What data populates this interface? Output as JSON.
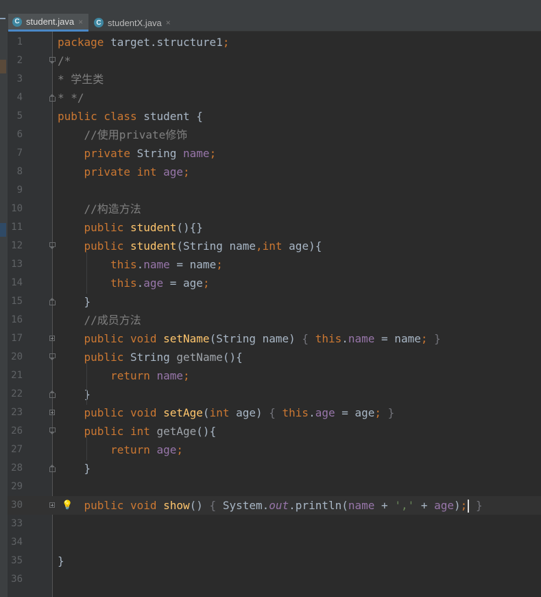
{
  "tabs": [
    {
      "label": "student.java",
      "active": true,
      "icon": "class-icon"
    },
    {
      "label": "studentX.java",
      "active": false,
      "icon": "class-icon"
    }
  ],
  "lines": [
    {
      "n": "1",
      "tokens": [
        [
          "kw",
          "package "
        ],
        [
          "pl",
          "target.structure1"
        ],
        [
          "kw",
          ";"
        ]
      ]
    },
    {
      "n": "2",
      "tokens": [
        [
          "cm",
          "/*"
        ]
      ],
      "fold": "open"
    },
    {
      "n": "3",
      "tokens": [
        [
          "cm",
          "* 学生类"
        ]
      ]
    },
    {
      "n": "4",
      "tokens": [
        [
          "cm",
          "* */"
        ]
      ],
      "fold": "close"
    },
    {
      "n": "5",
      "tokens": [
        [
          "kw",
          "public class "
        ],
        [
          "pl",
          "student {"
        ]
      ]
    },
    {
      "n": "6",
      "tokens": [
        [
          "pl",
          "    "
        ],
        [
          "cm",
          "//使用private修饰"
        ]
      ]
    },
    {
      "n": "7",
      "tokens": [
        [
          "pl",
          "    "
        ],
        [
          "kw",
          "private "
        ],
        [
          "pl",
          "String "
        ],
        [
          "fld",
          "name"
        ],
        [
          "kw",
          ";"
        ]
      ]
    },
    {
      "n": "8",
      "tokens": [
        [
          "pl",
          "    "
        ],
        [
          "kw",
          "private int "
        ],
        [
          "fld",
          "age"
        ],
        [
          "kw",
          ";"
        ]
      ]
    },
    {
      "n": "9",
      "tokens": []
    },
    {
      "n": "10",
      "tokens": [
        [
          "pl",
          "    "
        ],
        [
          "cm",
          "//构造方法"
        ]
      ]
    },
    {
      "n": "11",
      "tokens": [
        [
          "pl",
          "    "
        ],
        [
          "kw",
          "public "
        ],
        [
          "fn",
          "student"
        ],
        [
          "pl",
          "(){}"
        ]
      ]
    },
    {
      "n": "12",
      "tokens": [
        [
          "pl",
          "    "
        ],
        [
          "kw",
          "public "
        ],
        [
          "fn",
          "student"
        ],
        [
          "pl",
          "(String name"
        ],
        [
          "kw",
          ","
        ],
        [
          "kw",
          "int "
        ],
        [
          "pl",
          "age){"
        ]
      ],
      "fold": "open"
    },
    {
      "n": "13",
      "tokens": [
        [
          "pl",
          "        "
        ],
        [
          "kw",
          "this"
        ],
        [
          "pl",
          "."
        ],
        [
          "fld",
          "name"
        ],
        [
          "pl",
          " = name"
        ],
        [
          "kw",
          ";"
        ]
      ]
    },
    {
      "n": "14",
      "tokens": [
        [
          "pl",
          "        "
        ],
        [
          "kw",
          "this"
        ],
        [
          "pl",
          "."
        ],
        [
          "fld",
          "age"
        ],
        [
          "pl",
          " = age"
        ],
        [
          "kw",
          ";"
        ]
      ]
    },
    {
      "n": "15",
      "tokens": [
        [
          "pl",
          "    }"
        ]
      ],
      "fold": "close"
    },
    {
      "n": "16",
      "tokens": [
        [
          "pl",
          "    "
        ],
        [
          "cm",
          "//成员方法"
        ]
      ]
    },
    {
      "n": "17",
      "tokens": [
        [
          "pl",
          "    "
        ],
        [
          "kw",
          "public void "
        ],
        [
          "fn",
          "setName"
        ],
        [
          "pl",
          "(String name)"
        ],
        [
          "gray",
          " { "
        ],
        [
          "kw",
          "this"
        ],
        [
          "pl",
          "."
        ],
        [
          "fld",
          "name"
        ],
        [
          "pl",
          " = name"
        ],
        [
          "kw",
          ";"
        ],
        [
          "gray",
          " }"
        ]
      ],
      "fold": "collapsed"
    },
    {
      "n": "20",
      "tokens": [
        [
          "pl",
          "    "
        ],
        [
          "kw",
          "public "
        ],
        [
          "pl",
          "String "
        ],
        [
          "fn-dim",
          "getName"
        ],
        [
          "pl",
          "(){"
        ]
      ],
      "fold": "open"
    },
    {
      "n": "21",
      "tokens": [
        [
          "pl",
          "        "
        ],
        [
          "kw",
          "return "
        ],
        [
          "fld",
          "name"
        ],
        [
          "kw",
          ";"
        ]
      ]
    },
    {
      "n": "22",
      "tokens": [
        [
          "pl",
          "    }"
        ]
      ],
      "fold": "close"
    },
    {
      "n": "23",
      "tokens": [
        [
          "pl",
          "    "
        ],
        [
          "kw",
          "public void "
        ],
        [
          "fn",
          "setAge"
        ],
        [
          "pl",
          "("
        ],
        [
          "kw",
          "int "
        ],
        [
          "pl",
          "age)"
        ],
        [
          "gray",
          " { "
        ],
        [
          "kw",
          "this"
        ],
        [
          "pl",
          "."
        ],
        [
          "fld",
          "age"
        ],
        [
          "pl",
          " = age"
        ],
        [
          "kw",
          ";"
        ],
        [
          "gray",
          " }"
        ]
      ],
      "fold": "collapsed"
    },
    {
      "n": "26",
      "tokens": [
        [
          "pl",
          "    "
        ],
        [
          "kw",
          "public int "
        ],
        [
          "fn-dim",
          "getAge"
        ],
        [
          "pl",
          "(){"
        ]
      ],
      "fold": "open"
    },
    {
      "n": "27",
      "tokens": [
        [
          "pl",
          "        "
        ],
        [
          "kw",
          "return "
        ],
        [
          "fld",
          "age"
        ],
        [
          "kw",
          ";"
        ]
      ]
    },
    {
      "n": "28",
      "tokens": [
        [
          "pl",
          "    }"
        ]
      ],
      "fold": "close"
    },
    {
      "n": "29",
      "tokens": []
    },
    {
      "n": "30",
      "tokens": [
        [
          "pl",
          "    "
        ],
        [
          "kw",
          "public void "
        ],
        [
          "fn",
          "show"
        ],
        [
          "pl",
          "()"
        ],
        [
          "gray",
          " { "
        ],
        [
          "pl",
          "System."
        ],
        [
          "fld-i",
          "out"
        ],
        [
          "pl",
          ".println("
        ],
        [
          "fld",
          "name"
        ],
        [
          "pl",
          " + "
        ],
        [
          "str",
          "','"
        ],
        [
          "pl",
          " + "
        ],
        [
          "fld",
          "age"
        ],
        [
          "pl",
          ")"
        ],
        [
          "kw",
          ";"
        ],
        [
          "caret",
          ""
        ],
        [
          "gray",
          " }"
        ]
      ],
      "fold": "collapsed",
      "current": true,
      "bulb": true
    },
    {
      "n": "33",
      "tokens": []
    },
    {
      "n": "34",
      "tokens": []
    },
    {
      "n": "35",
      "tokens": [
        [
          "pl",
          "}"
        ]
      ]
    },
    {
      "n": "36",
      "tokens": []
    }
  ]
}
